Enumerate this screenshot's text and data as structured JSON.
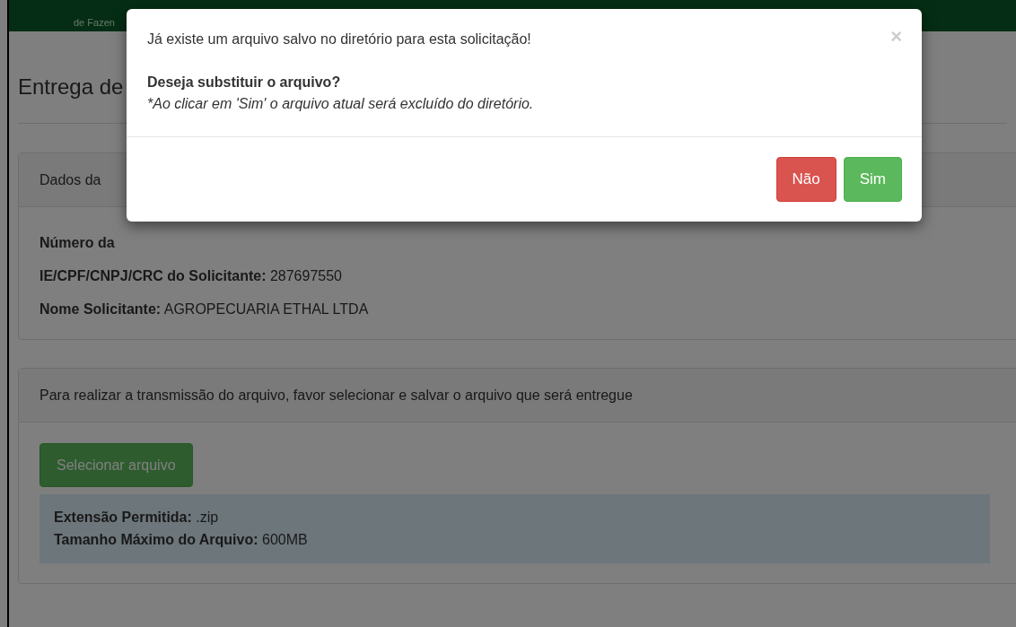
{
  "header": {
    "text": "de Fazen"
  },
  "page": {
    "title": "Entrega de"
  },
  "request_panel": {
    "heading": "Dados da",
    "fields": [
      {
        "label": "Número da"
      },
      {
        "label": "IE/CPF/CNPJ/CRC do Solicitante:",
        "value": "287697550"
      },
      {
        "label": "Nome Solicitante:",
        "value": "AGROPECUARIA ETHAL LTDA"
      }
    ]
  },
  "upload_panel": {
    "heading": "Para realizar a transmissão do arquivo, favor selecionar e salvar o arquivo que será entregue",
    "button": "Selecionar arquivo",
    "info": [
      {
        "label": "Extensão Permitida:",
        "value": ".zip"
      },
      {
        "label": "Tamanho Máximo do Arquivo:",
        "value": "600MB"
      }
    ]
  },
  "modal": {
    "message": "Já existe um arquivo salvo no diretório para esta solicitação!",
    "close": "×",
    "question": "Deseja substituir o arquivo?",
    "note": "*Ao clicar em 'Sim' o arquivo atual será excluído do diretório.",
    "buttons": [
      {
        "label": "Não",
        "kind": "danger"
      },
      {
        "label": "Sim",
        "kind": "success"
      }
    ]
  }
}
